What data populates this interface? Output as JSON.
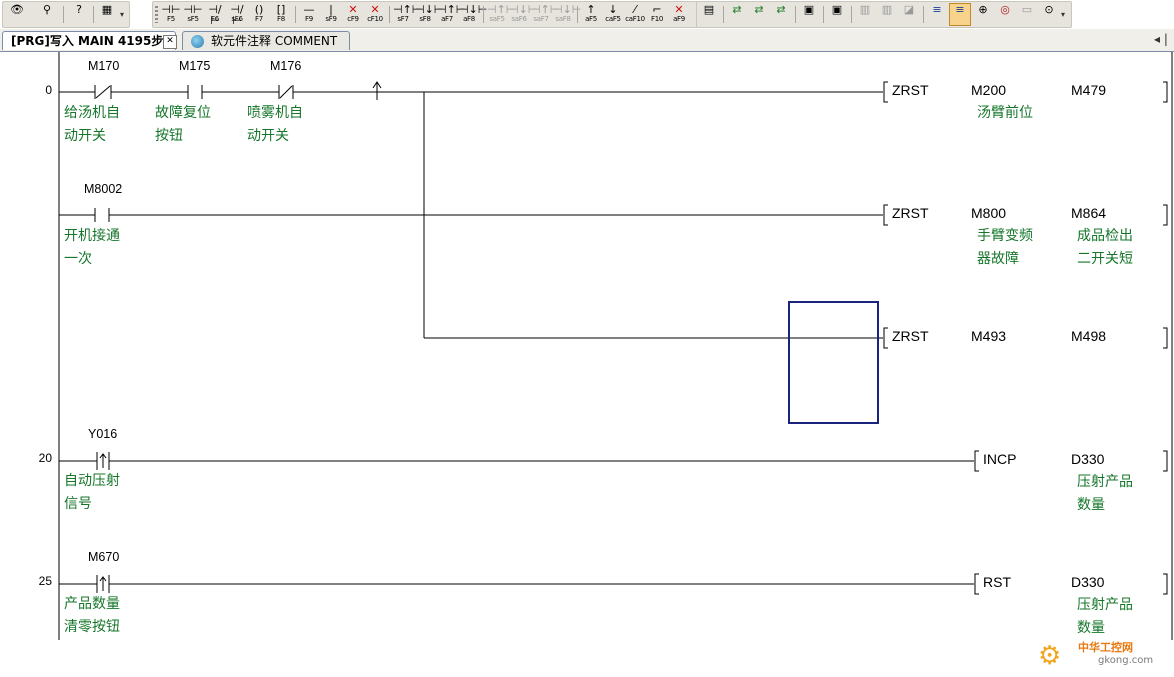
{
  "toolbar": {
    "groups": [
      {
        "buttons": [
          {
            "glyph": "👁",
            "key": "",
            "icon": "view-icon"
          },
          {
            "glyph": "⚲",
            "key": "",
            "icon": "find-icon"
          },
          {
            "glyph": "?",
            "key": "",
            "icon": "help-icon"
          },
          {
            "glyph": "▦",
            "key": "",
            "icon": "binoculars-icon"
          }
        ]
      },
      {
        "buttons": [
          {
            "glyph": "⊣⊢",
            "key": "F5",
            "icon": "contact-no-icon"
          },
          {
            "glyph": "⊣⊢",
            "key": "sF5",
            "icon": "contact-parallel-no-icon"
          },
          {
            "glyph": "⊣/⊢",
            "key": "F6",
            "icon": "contact-nc-icon"
          },
          {
            "glyph": "⊣/⊢",
            "key": "sF6",
            "icon": "contact-parallel-nc-icon"
          },
          {
            "glyph": "()",
            "key": "F7",
            "icon": "coil-icon"
          },
          {
            "glyph": "[]",
            "key": "F8",
            "icon": "instruction-icon"
          },
          {
            "glyph": "—",
            "key": "F9",
            "icon": "horizontal-line-icon"
          },
          {
            "glyph": "|",
            "key": "sF9",
            "icon": "vertical-line-icon"
          },
          {
            "glyph": "✕",
            "key": "cF9",
            "icon": "delete-horizontal-icon"
          },
          {
            "glyph": "✕",
            "key": "cF10",
            "icon": "delete-vertical-icon"
          },
          {
            "glyph": "⊣↑⊢",
            "key": "sF7",
            "icon": "rising-pulse-icon"
          },
          {
            "glyph": "⊣↓⊢",
            "key": "sF8",
            "icon": "falling-pulse-icon"
          },
          {
            "glyph": "⊣↑⊢",
            "key": "aF7",
            "icon": "parallel-rising-pulse-icon"
          },
          {
            "glyph": "⊣↓⊢",
            "key": "aF8",
            "icon": "parallel-falling-pulse-icon"
          },
          {
            "glyph": "⊣↑⊢",
            "key": "saF5",
            "icon": "rising-pulse-inverse-icon"
          },
          {
            "glyph": "⊣↓⊢",
            "key": "saF6",
            "icon": "falling-pulse-inverse-icon"
          },
          {
            "glyph": "⊣↑⊢",
            "key": "saF7",
            "icon": "parallel-rising-inverse-icon"
          },
          {
            "glyph": "⊣↓⊢",
            "key": "saF8",
            "icon": "parallel-falling-inverse-icon"
          },
          {
            "glyph": "↑",
            "key": "aF5",
            "icon": "operation-rising-icon"
          },
          {
            "glyph": "↓",
            "key": "caF5",
            "icon": "operation-falling-icon"
          },
          {
            "glyph": "⁄",
            "key": "caF10",
            "icon": "invert-result-icon"
          },
          {
            "glyph": "⌐",
            "key": "F10",
            "icon": "draw-line-icon"
          },
          {
            "glyph": "✕",
            "key": "aF9",
            "icon": "erase-line-icon"
          }
        ]
      },
      {
        "buttons": [
          {
            "glyph": "▤",
            "key": "",
            "icon": "list-icon"
          },
          {
            "glyph": "⇄",
            "key": "",
            "icon": "convert-icon"
          },
          {
            "glyph": "⇄",
            "key": "",
            "icon": "convert-all-icon"
          },
          {
            "glyph": "⇄",
            "key": "",
            "icon": "online-change-icon"
          },
          {
            "glyph": "▣",
            "key": "",
            "icon": "comment-icon"
          },
          {
            "glyph": "▣",
            "key": "",
            "icon": "statement-icon"
          },
          {
            "glyph": "▥",
            "key": "",
            "icon": "note-icon"
          },
          {
            "glyph": "▥",
            "key": "",
            "icon": "alias-icon"
          },
          {
            "glyph": "◪",
            "key": "",
            "icon": "monitor-icon"
          },
          {
            "glyph": "≡",
            "key": "",
            "icon": "ladder-mode-icon"
          },
          {
            "glyph": "≡",
            "key": "",
            "icon": "ladder-monitor-icon"
          },
          {
            "glyph": "⊕",
            "key": "",
            "icon": "zoom-icon"
          },
          {
            "glyph": "◎",
            "key": "",
            "icon": "device-test-icon"
          },
          {
            "glyph": "▭",
            "key": "",
            "icon": "window-icon"
          },
          {
            "glyph": "⊙",
            "key": "",
            "icon": "search-icon"
          }
        ]
      }
    ]
  },
  "tabs": [
    {
      "label": "[PRG]写入 MAIN 4195步",
      "active": true
    },
    {
      "label": "软元件注释 COMMENT",
      "active": false
    }
  ],
  "tab_scroll": "◂ |",
  "ladder": {
    "rung_numbers": [
      "0",
      "20",
      "25"
    ],
    "contacts": [
      {
        "device": "M170",
        "comment": "给汤机自\n动开关"
      },
      {
        "device": "M175",
        "comment": "故障复位\n按钮"
      },
      {
        "device": "M176",
        "comment": "喷雾机自\n动开关"
      },
      {
        "device": "M8002",
        "comment": "开机接通\n一次"
      },
      {
        "device": "Y016",
        "comment": "自动压射\n信号"
      },
      {
        "device": "M670",
        "comment": "产品数量\n清零按钮"
      }
    ],
    "instructions": [
      {
        "op": "ZRST",
        "arg1": "M200",
        "arg1_comment": "汤臂前位",
        "arg2": "M479",
        "arg2_comment": ""
      },
      {
        "op": "ZRST",
        "arg1": "M800",
        "arg1_comment": "手臂变频\n器故障",
        "arg2": "M864",
        "arg2_comment": "成品检出\n二开关短"
      },
      {
        "op": "ZRST",
        "arg1": "M493",
        "arg1_comment": "",
        "arg2": "M498",
        "arg2_comment": ""
      },
      {
        "op": "INCP",
        "arg1": "D330",
        "arg1_comment": "压射产品\n数量",
        "arg2": "",
        "arg2_comment": ""
      },
      {
        "op": "RST",
        "arg1": "D330",
        "arg1_comment": "压射产品\n数量",
        "arg2": "",
        "arg2_comment": ""
      }
    ]
  },
  "watermark": {
    "line1": "中华工控网",
    "line2": "gkong.com"
  },
  "colors": {
    "comment": "#15762a",
    "cursor": "#1a237e",
    "tab_border": "#7a8ca8"
  }
}
